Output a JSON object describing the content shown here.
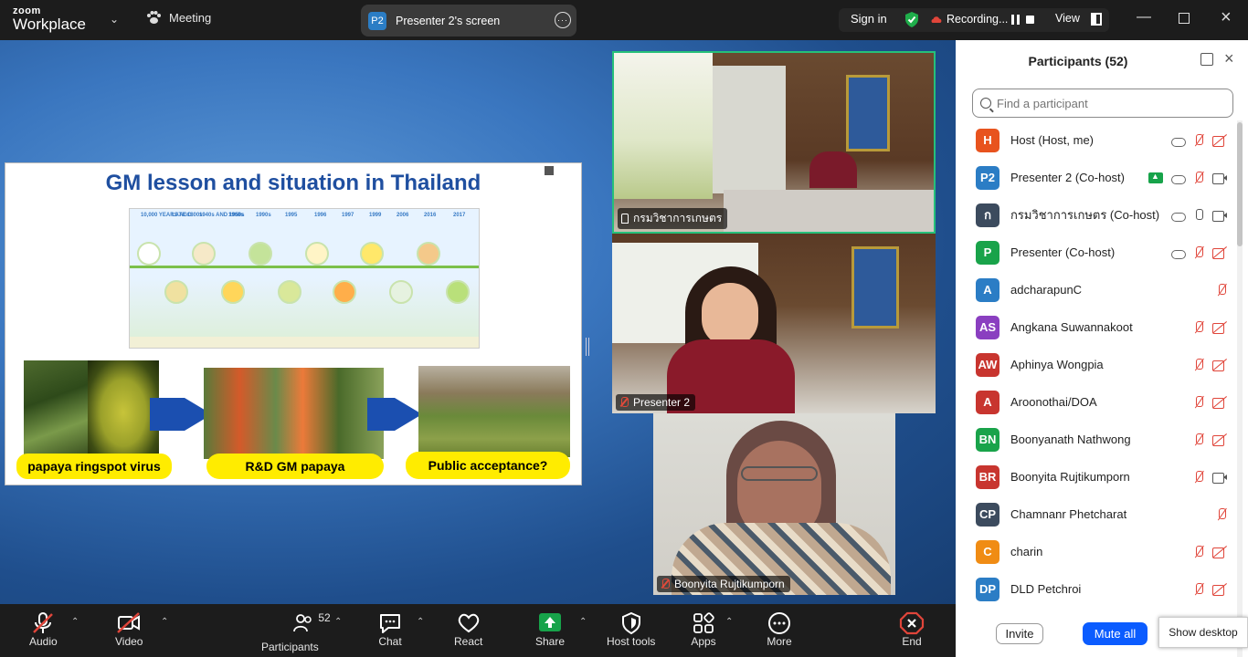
{
  "topbar": {
    "brand_small": "zoom",
    "brand_large": "Workplace",
    "meeting_label": "Meeting",
    "screen_badge": "P2",
    "screen_label": "Presenter 2's screen",
    "sign_in": "Sign in",
    "recording": "Recording...",
    "view": "View"
  },
  "slide": {
    "title": "GM lesson and situation in Thailand",
    "years": [
      "10,000 YEARS AGO",
      "LATE 1800s",
      "1940s AND 1950s",
      "1960s",
      "1990s",
      "1995",
      "1996",
      "1997",
      "1999",
      "2006",
      "2016",
      "2017"
    ],
    "label_virus": "papaya ringspot virus",
    "label_rd": "R&D GM papaya",
    "label_public": "Public acceptance?"
  },
  "tiles": [
    {
      "name": "กรมวิชาการเกษตร"
    },
    {
      "name": "Presenter 2"
    },
    {
      "name": "Boonyita Rujtikumporn"
    }
  ],
  "panel": {
    "title": "Participants (52)",
    "search_placeholder": "Find a participant",
    "invite": "Invite",
    "mute_all": "Mute all",
    "participants": [
      {
        "initials": "H",
        "name": "Host (Host, me)",
        "color": "#e8531e",
        "icons": [
          "cloud",
          "micoff",
          "camoff"
        ]
      },
      {
        "initials": "P2",
        "name": "Presenter 2 (Co-host)",
        "color": "#2b7dc5",
        "icons": [
          "share",
          "cloud",
          "micoff",
          "camon"
        ]
      },
      {
        "initials": "ก",
        "name": "กรมวิชาการเกษตร (Co-host)",
        "color": "#3c4b5e",
        "icons": [
          "cloud",
          "micon",
          "camon"
        ]
      },
      {
        "initials": "P",
        "name": "Presenter (Co-host)",
        "color": "#19a34a",
        "icons": [
          "cloud",
          "micoff",
          "camoff"
        ]
      },
      {
        "initials": "A",
        "name": "adcharapunC",
        "color": "#2b7dc5",
        "icons": [
          "micoff"
        ]
      },
      {
        "initials": "AS",
        "name": "Angkana Suwannakoot",
        "color": "#8a3fc0",
        "icons": [
          "micoff",
          "camoff"
        ]
      },
      {
        "initials": "AW",
        "name": "Aphinya Wongpia",
        "color": "#c8352f",
        "icons": [
          "micoff",
          "camoff"
        ]
      },
      {
        "initials": "A",
        "name": "Aroonothai/DOA",
        "color": "#c8352f",
        "icons": [
          "micoff",
          "camoff"
        ]
      },
      {
        "initials": "BN",
        "name": "Boonyanath Nathwong",
        "color": "#19a34a",
        "icons": [
          "micoff",
          "camoff"
        ]
      },
      {
        "initials": "BR",
        "name": "Boonyita Rujtikumporn",
        "color": "#c8352f",
        "icons": [
          "micoff",
          "camon"
        ]
      },
      {
        "initials": "CP",
        "name": "Chamnanr Phetcharat",
        "color": "#3c4b5e",
        "icons": [
          "micoff"
        ]
      },
      {
        "initials": "C",
        "name": "charin",
        "color": "#f08c14",
        "icons": [
          "micoff",
          "camoff"
        ]
      },
      {
        "initials": "DP",
        "name": "DLD Petchroi",
        "color": "#2b7dc5",
        "icons": [
          "micoff",
          "camoff"
        ]
      }
    ]
  },
  "show_desktop": "Show desktop",
  "toolbar": {
    "audio": "Audio",
    "video": "Video",
    "participants": "Participants",
    "participants_count": "52",
    "chat": "Chat",
    "react": "React",
    "share": "Share",
    "host_tools": "Host tools",
    "apps": "Apps",
    "more": "More",
    "end": "End"
  },
  "colors": {
    "accent": "#0b5cff",
    "share_green": "#17a34a",
    "end_red": "#e0453a",
    "slide_title": "#1f4fa0",
    "label_yellow": "#ffec00"
  }
}
